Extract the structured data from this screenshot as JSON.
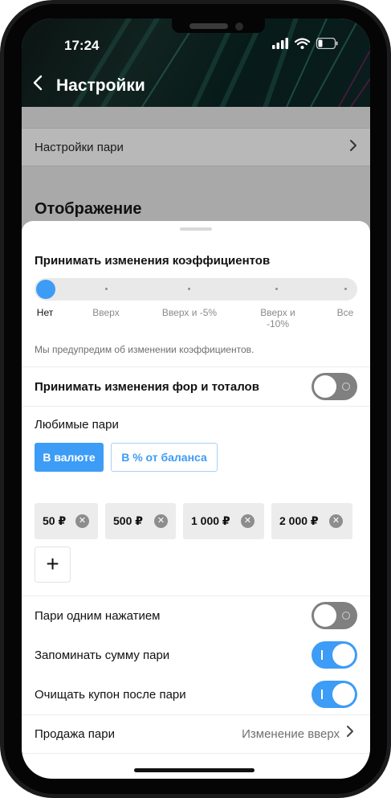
{
  "status_bar": {
    "time": "17:24"
  },
  "header": {
    "title": "Настройки"
  },
  "background": {
    "row_label": "Настройки пари",
    "section_heading": "Отображение"
  },
  "sheet": {
    "odds_changes": {
      "title": "Принимать изменения коэффициентов",
      "options": [
        "Нет",
        "Вверх",
        "Вверх и -5%",
        "Вверх и\n-10%",
        "Все"
      ],
      "selected": "Нет",
      "hint": "Мы предупредим об изменении коэффициентов."
    },
    "handicap_totals": {
      "label": "Принимать изменения фор и тоталов",
      "enabled": false
    },
    "favorite_bets": {
      "label": "Любимые пари",
      "tabs": [
        "В валюте",
        "В % от баланса"
      ],
      "active_tab": "В валюте",
      "amounts": [
        "50 ₽",
        "500 ₽",
        "1 000 ₽",
        "2 000 ₽"
      ],
      "add_label": "+"
    },
    "one_click": {
      "label": "Пари одним нажатием",
      "enabled": false
    },
    "remember_sum": {
      "label": "Запоминать сумму пари",
      "enabled": true
    },
    "clear_coupon": {
      "label": "Очищать купон после пари",
      "enabled": true
    },
    "sell_bet": {
      "label": "Продажа пари",
      "value": "Изменение вверх"
    }
  },
  "colors": {
    "accent": "#3d9cf5",
    "toggle_off": "#808080",
    "chip_bg": "#ececec",
    "header_bg": "#0b1412"
  },
  "icons": [
    "back-arrow-icon",
    "signal-icon",
    "wifi-icon",
    "battery-icon",
    "chevron-right-icon",
    "remove-icon",
    "plus-icon"
  ]
}
